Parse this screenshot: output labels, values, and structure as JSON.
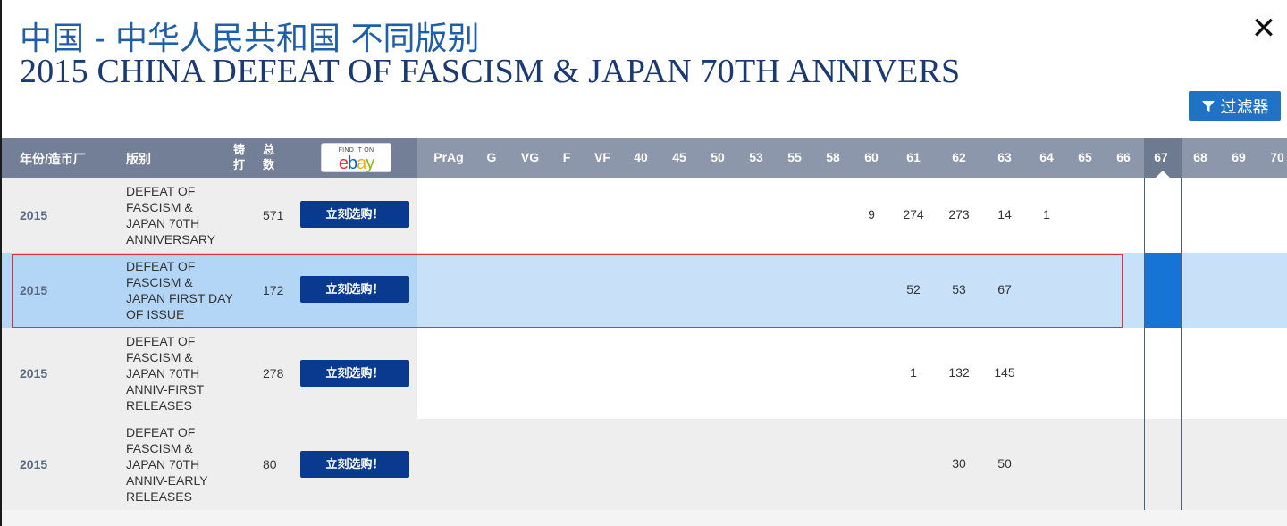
{
  "header": {
    "title_cn": "中国 - 中华人民共和国 不同版别",
    "title_en": "2015 CHINA DEFEAT OF FASCISM & JAPAN 70TH ANNIVERS",
    "close_label": "✕",
    "filter_label": "过滤器",
    "filter_icon": "funnel-icon"
  },
  "table": {
    "columns": {
      "year_mint": "年份/造币厂",
      "variety": "版别",
      "mintage_line1": "铸",
      "mintage_line2": "打",
      "total_line1": "总",
      "total_line2": "数",
      "ebay_find": "FIND IT ON",
      "ebay_logo": "ebay"
    },
    "grades": [
      "PrAg",
      "G",
      "VG",
      "F",
      "VF",
      "40",
      "45",
      "50",
      "53",
      "55",
      "58",
      "60",
      "61",
      "62",
      "63",
      "64",
      "65",
      "66",
      "67",
      "68",
      "69",
      "70"
    ],
    "selected_grade": "67",
    "rows": [
      {
        "year": "2015",
        "variety": "DEFEAT OF FASCISM & JAPAN 70TH ANNIVERSARY",
        "total": "571",
        "buy_label": "立刻选购！",
        "pops": {
          "60": "9",
          "61": "274",
          "62": "273",
          "63": "14",
          "64": "1"
        }
      },
      {
        "year": "2015",
        "variety": "DEFEAT OF FASCISM & JAPAN FIRST DAY OF ISSUE",
        "total": "172",
        "buy_label": "立刻选购！",
        "pops": {
          "61": "52",
          "62": "53",
          "63": "67"
        }
      },
      {
        "year": "2015",
        "variety": "DEFEAT OF FASCISM & JAPAN 70TH ANNIV-FIRST RELEASES",
        "total": "278",
        "buy_label": "立刻选购！",
        "pops": {
          "61": "1",
          "62": "132",
          "63": "145"
        }
      },
      {
        "year": "2015",
        "variety": "DEFEAT OF FASCISM & JAPAN 70TH ANNIV-EARLY RELEASES",
        "total": "80",
        "buy_label": "立刻选购！",
        "pops": {
          "62": "30",
          "63": "50"
        }
      }
    ]
  },
  "colors": {
    "title_cn": "#1f5fa8",
    "title_en": "#1b3a73",
    "filter_button": "#1f72c4",
    "buy_button": "#0a3a8f",
    "selected_row": "#c8e1f9",
    "selected_cell": "#1574d6",
    "row_highlight_border": "#e0303e"
  }
}
